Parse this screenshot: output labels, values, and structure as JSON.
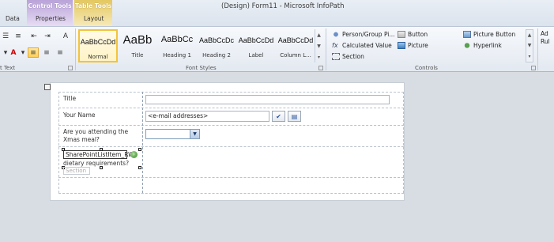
{
  "window": {
    "title": "(Design) Form11  -  Microsoft InfoPath"
  },
  "context_tabs": {
    "control_tools": "Control Tools",
    "table_tools": "Table Tools"
  },
  "tabs": [
    "Data",
    "Properties",
    "Layout"
  ],
  "ribbon": {
    "format_text_label": "t Text",
    "font_styles": {
      "label": "Font Styles",
      "items": [
        {
          "sample": "AaBbCcDd",
          "label": "Normal",
          "selected": true
        },
        {
          "sample": "AaBb",
          "label": "Title",
          "selected": false
        },
        {
          "sample": "AaBbCc",
          "label": "Heading 1",
          "selected": false
        },
        {
          "sample": "AaBbCcDc",
          "label": "Heading 2",
          "selected": false
        },
        {
          "sample": "AaBbCcDd",
          "label": "Label",
          "selected": false
        },
        {
          "sample": "AaBbCcDd",
          "label": "Column L...",
          "selected": false
        }
      ]
    },
    "controls": {
      "label": "Controls",
      "items": [
        {
          "label": "Person/Group Pi...",
          "icon": "person-group-icon"
        },
        {
          "label": "Button",
          "icon": "button-icon"
        },
        {
          "label": "Picture Button",
          "icon": "picture-button-icon"
        },
        {
          "label": "Calculated Value",
          "icon": "calculated-value-icon"
        },
        {
          "label": "Picture",
          "icon": "picture-icon"
        },
        {
          "label": "Hyperlink",
          "icon": "hyperlink-icon"
        },
        {
          "label": "Section",
          "icon": "section-icon"
        }
      ]
    },
    "add_rule": "Ad\nRul"
  },
  "form": {
    "rows": [
      {
        "label": "Title"
      },
      {
        "label": "Your Name",
        "value": "<e-mail addresses>"
      },
      {
        "label": "Are you attending the Xmas meal?"
      },
      {
        "label": "dietary requirements?"
      }
    ],
    "selected_control": "SharePointListItem_RW",
    "section_tag": "Section"
  },
  "colors": {
    "accent_selected": "#f2c33d",
    "control_tools_tab": "#b9a3d8",
    "table_tools_tab": "#e4c760"
  }
}
